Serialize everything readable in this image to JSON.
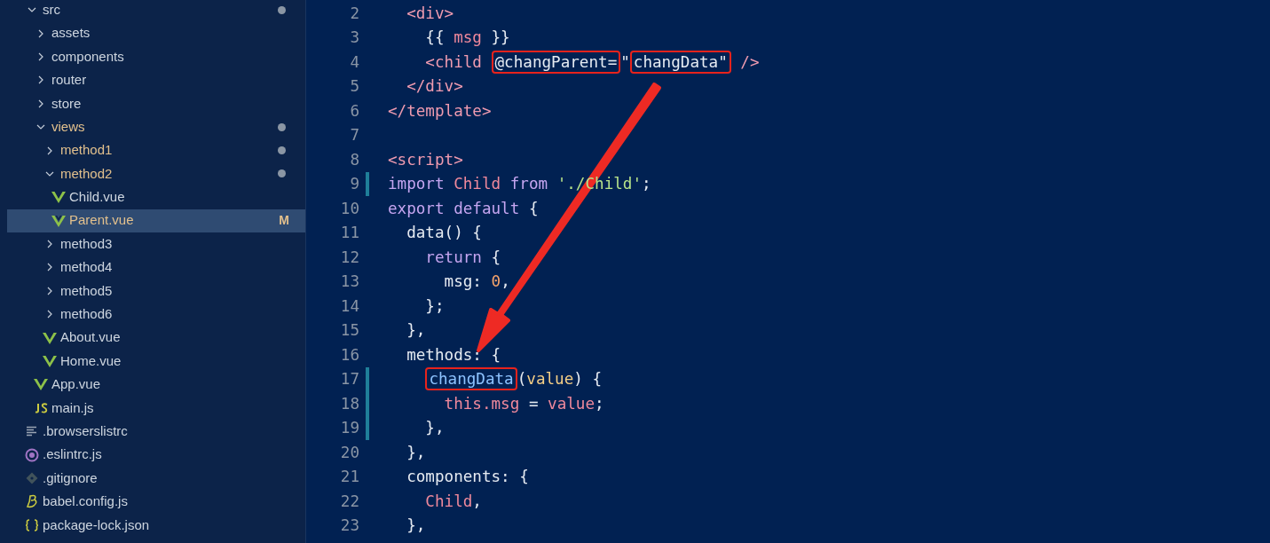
{
  "explorer": {
    "items": [
      {
        "kind": "folder",
        "label": "src",
        "expanded": true,
        "dot": true,
        "changed": false,
        "selected": false,
        "children": [
          {
            "kind": "folder",
            "label": "assets",
            "expanded": false,
            "dot": false,
            "changed": false,
            "selected": false
          },
          {
            "kind": "folder",
            "label": "components",
            "expanded": false,
            "dot": false,
            "changed": false,
            "selected": false
          },
          {
            "kind": "folder",
            "label": "router",
            "expanded": false,
            "dot": false,
            "changed": false,
            "selected": false
          },
          {
            "kind": "folder",
            "label": "store",
            "expanded": false,
            "dot": false,
            "changed": false,
            "selected": false
          },
          {
            "kind": "folder",
            "label": "views",
            "expanded": true,
            "dot": true,
            "changed": true,
            "selected": false,
            "children": [
              {
                "kind": "folder",
                "label": "method1",
                "expanded": false,
                "dot": true,
                "changed": true,
                "selected": false
              },
              {
                "kind": "folder",
                "label": "method2",
                "expanded": true,
                "dot": true,
                "changed": true,
                "selected": false,
                "children": [
                  {
                    "kind": "vue",
                    "label": "Child.vue",
                    "dot": false,
                    "changed": false,
                    "selected": false
                  },
                  {
                    "kind": "vue",
                    "label": "Parent.vue",
                    "dot": false,
                    "changed": true,
                    "selected": true,
                    "badge": "M"
                  }
                ]
              },
              {
                "kind": "folder",
                "label": "method3",
                "expanded": false,
                "dot": false,
                "changed": false,
                "selected": false
              },
              {
                "kind": "folder",
                "label": "method4",
                "expanded": false,
                "dot": false,
                "changed": false,
                "selected": false
              },
              {
                "kind": "folder",
                "label": "method5",
                "expanded": false,
                "dot": false,
                "changed": false,
                "selected": false
              },
              {
                "kind": "folder",
                "label": "method6",
                "expanded": false,
                "dot": false,
                "changed": false,
                "selected": false
              },
              {
                "kind": "vue",
                "label": "About.vue",
                "dot": false,
                "changed": false,
                "selected": false
              },
              {
                "kind": "vue",
                "label": "Home.vue",
                "dot": false,
                "changed": false,
                "selected": false
              }
            ]
          },
          {
            "kind": "vue",
            "label": "App.vue",
            "dot": false,
            "changed": false,
            "selected": false
          },
          {
            "kind": "js",
            "label": "main.js",
            "dot": false,
            "changed": false,
            "selected": false
          }
        ]
      },
      {
        "kind": "text",
        "label": ".browserslistrc",
        "dot": false,
        "changed": false,
        "selected": false
      },
      {
        "kind": "eslint",
        "label": ".eslintrc.js",
        "dot": false,
        "changed": false,
        "selected": false
      },
      {
        "kind": "git",
        "label": ".gitignore",
        "dot": false,
        "changed": false,
        "selected": false
      },
      {
        "kind": "babel",
        "label": "babel.config.js",
        "dot": false,
        "changed": false,
        "selected": false
      },
      {
        "kind": "json",
        "label": "package-lock.json",
        "dot": false,
        "changed": false,
        "selected": false
      }
    ]
  },
  "editor": {
    "lines": [
      {
        "number": "2",
        "changed": false,
        "tokens": [
          {
            "text": "  <div>",
            "kind": "tag"
          }
        ]
      },
      {
        "number": "3",
        "changed": false,
        "tokens": [
          {
            "text": "    {{ ",
            "kind": "plain"
          },
          {
            "text": "msg",
            "kind": "variable"
          },
          {
            "text": " }}",
            "kind": "plain"
          }
        ]
      },
      {
        "number": "4",
        "changed": false,
        "tokens": [
          {
            "text": "    <child ",
            "kind": "tag"
          },
          {
            "text": "@changParent=",
            "kind": "plain",
            "boxed": true
          },
          {
            "text": "\"",
            "kind": "plain"
          },
          {
            "text": "changData\"",
            "kind": "plain",
            "boxed": true
          },
          {
            "text": " />",
            "kind": "tag"
          }
        ]
      },
      {
        "number": "5",
        "changed": false,
        "tokens": [
          {
            "text": "  </div>",
            "kind": "tag"
          }
        ]
      },
      {
        "number": "6",
        "changed": false,
        "tokens": [
          {
            "text": "</template>",
            "kind": "tag"
          }
        ]
      },
      {
        "number": "7",
        "changed": false
      },
      {
        "number": "8",
        "changed": false,
        "tokens": [
          {
            "text": "<script>",
            "kind": "tag"
          }
        ]
      },
      {
        "number": "9",
        "changed": true,
        "tokens": [
          {
            "text": "import ",
            "kind": "keyword"
          },
          {
            "text": "Child ",
            "kind": "variable"
          },
          {
            "text": "from ",
            "kind": "keyword"
          },
          {
            "text": "'./Child'",
            "kind": "string"
          },
          {
            "text": ";",
            "kind": "plain"
          }
        ]
      },
      {
        "number": "10",
        "changed": false,
        "tokens": [
          {
            "text": "export default ",
            "kind": "keyword"
          },
          {
            "text": "{",
            "kind": "plain"
          }
        ]
      },
      {
        "number": "11",
        "changed": false,
        "tokens": [
          {
            "text": "  data",
            "kind": "plain"
          },
          {
            "text": "() {",
            "kind": "plain"
          }
        ]
      },
      {
        "number": "12",
        "changed": false,
        "tokens": [
          {
            "text": "    return ",
            "kind": "keyword"
          },
          {
            "text": "{",
            "kind": "plain"
          }
        ]
      },
      {
        "number": "13",
        "changed": false,
        "tokens": [
          {
            "text": "      msg: ",
            "kind": "plain"
          },
          {
            "text": "0",
            "kind": "number"
          },
          {
            "text": ",",
            "kind": "plain"
          }
        ]
      },
      {
        "number": "14",
        "changed": false,
        "tokens": [
          {
            "text": "    };",
            "kind": "plain"
          }
        ]
      },
      {
        "number": "15",
        "changed": false,
        "tokens": [
          {
            "text": "  },",
            "kind": "plain"
          }
        ]
      },
      {
        "number": "16",
        "changed": false,
        "tokens": [
          {
            "text": "  methods: {",
            "kind": "plain"
          }
        ]
      },
      {
        "number": "17",
        "changed": true,
        "tokens": [
          {
            "text": "    changData",
            "kind": "function",
            "boxed": true
          },
          {
            "text": "(",
            "kind": "plain"
          },
          {
            "text": "value",
            "kind": "param"
          },
          {
            "text": ") {",
            "kind": "plain"
          }
        ]
      },
      {
        "number": "18",
        "changed": true,
        "tokens": [
          {
            "text": "      this.msg",
            "kind": "variable"
          },
          {
            "text": " = ",
            "kind": "plain"
          },
          {
            "text": "value",
            "kind": "variable"
          },
          {
            "text": ";",
            "kind": "plain"
          }
        ]
      },
      {
        "number": "19",
        "changed": true,
        "tokens": [
          {
            "text": "    },",
            "kind": "plain"
          }
        ]
      },
      {
        "number": "20",
        "changed": false,
        "tokens": [
          {
            "text": "  },",
            "kind": "plain"
          }
        ]
      },
      {
        "number": "21",
        "changed": false,
        "tokens": [
          {
            "text": "  components: {",
            "kind": "plain"
          }
        ]
      },
      {
        "number": "22",
        "changed": false,
        "tokens": [
          {
            "text": "    Child",
            "kind": "variable"
          },
          {
            "text": ",",
            "kind": "plain"
          }
        ]
      },
      {
        "number": "23",
        "changed": false,
        "tokens": [
          {
            "text": "  },",
            "kind": "plain"
          }
        ]
      }
    ]
  }
}
